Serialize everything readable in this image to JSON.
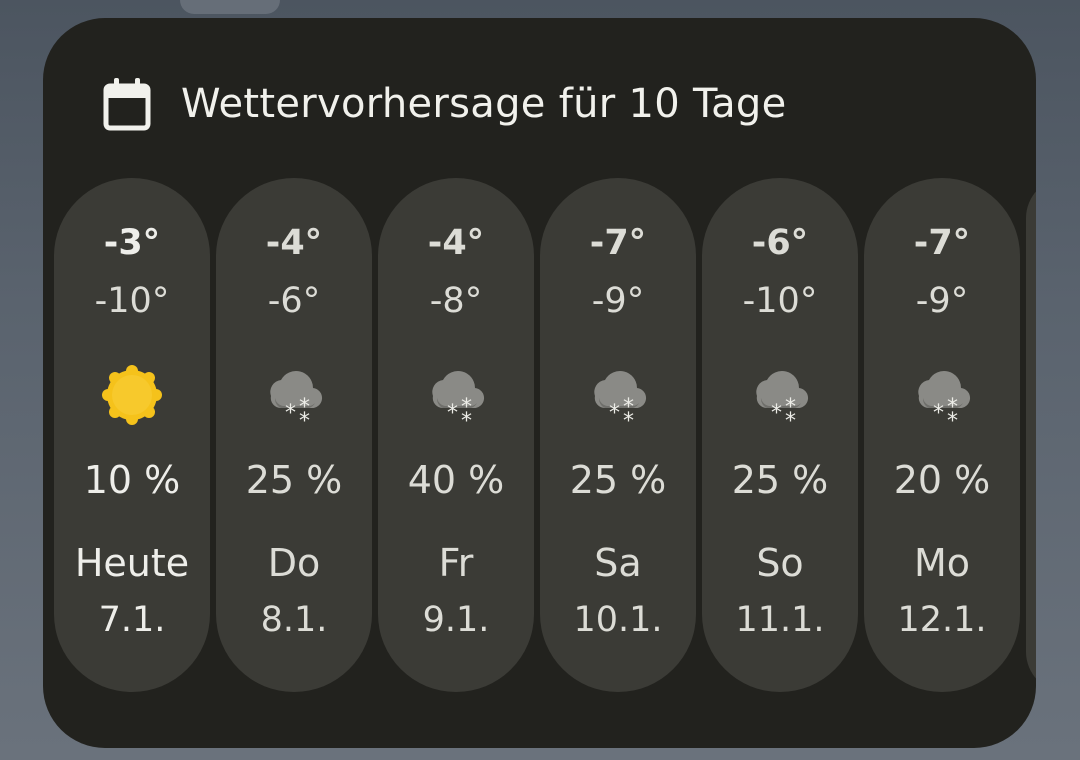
{
  "widget": {
    "title": "Wettervorhersage für 10 Tage",
    "header_icon": "calendar-icon"
  },
  "colors": {
    "background": "#22221e",
    "tile": "#3b3b36",
    "text": "#dcdcd6",
    "sun": "#f5c21b",
    "cloud": "#8a8a86"
  },
  "days": [
    {
      "high": "-3°",
      "low": "-10°",
      "icon": "sun-icon",
      "precip": "10 %",
      "name": "Heute",
      "date": "7.1."
    },
    {
      "high": "-4°",
      "low": "-6°",
      "icon": "snow-cloud-icon",
      "precip": "25 %",
      "name": "Do",
      "date": "8.1."
    },
    {
      "high": "-4°",
      "low": "-8°",
      "icon": "snow-cloud-icon",
      "precip": "40 %",
      "name": "Fr",
      "date": "9.1."
    },
    {
      "high": "-7°",
      "low": "-9°",
      "icon": "snow-cloud-icon",
      "precip": "25 %",
      "name": "Sa",
      "date": "10.1."
    },
    {
      "high": "-6°",
      "low": "-10°",
      "icon": "snow-cloud-icon",
      "precip": "25 %",
      "name": "So",
      "date": "11.1."
    },
    {
      "high": "-7°",
      "low": "-9°",
      "icon": "snow-cloud-icon",
      "precip": "20 %",
      "name": "Mo",
      "date": "12.1."
    }
  ]
}
